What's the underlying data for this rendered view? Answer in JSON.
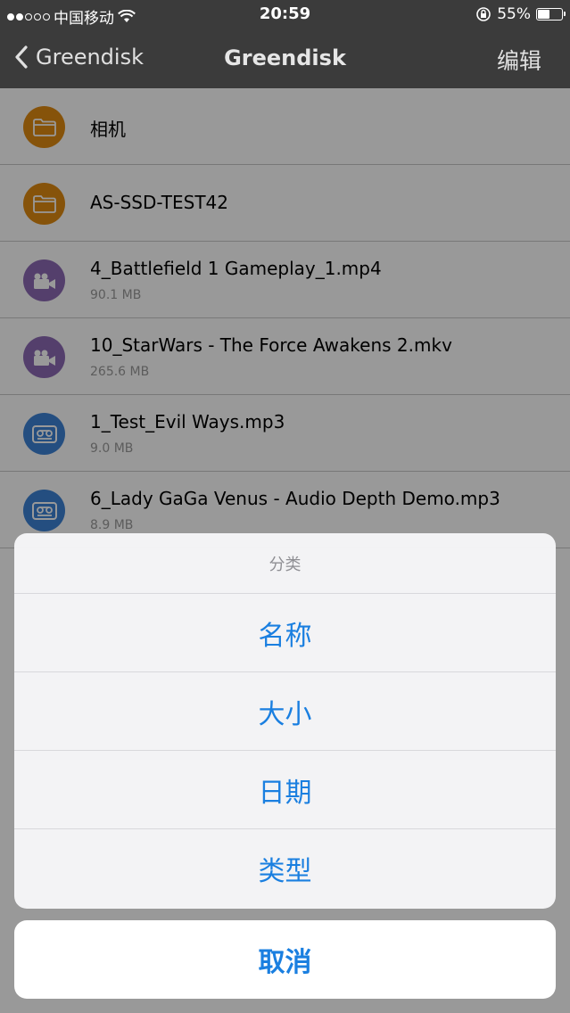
{
  "status": {
    "carrier": "中国移动",
    "time": "20:59",
    "battery": "55%",
    "battery_level": 0.55,
    "signal_bars_filled": 2,
    "signal_bars_total": 5
  },
  "nav": {
    "back_label": "Greendisk",
    "title": "Greendisk",
    "edit_label": "编辑"
  },
  "files": [
    {
      "name": "相机",
      "size": "",
      "type": "folder",
      "color": "#E08A12"
    },
    {
      "name": "AS-SSD-TEST42",
      "size": "",
      "type": "folder",
      "color": "#E08A12"
    },
    {
      "name": "4_Battlefield 1 Gameplay_1.mp4",
      "size": "90.1 MB",
      "type": "video",
      "color": "#8C6AB5"
    },
    {
      "name": "10_StarWars - The Force Awakens 2.mkv",
      "size": "265.6 MB",
      "type": "video",
      "color": "#8C6AB5"
    },
    {
      "name": "1_Test_Evil Ways.mp3",
      "size": "9.0 MB",
      "type": "audio",
      "color": "#3D82D6"
    },
    {
      "name": "6_Lady  GaGa Venus - Audio Depth Demo.mp3",
      "size": "8.9 MB",
      "type": "audio",
      "color": "#3D82D6"
    }
  ],
  "sheet": {
    "title": "分类",
    "options": [
      "名称",
      "大小",
      "日期",
      "类型"
    ],
    "cancel": "取消"
  }
}
